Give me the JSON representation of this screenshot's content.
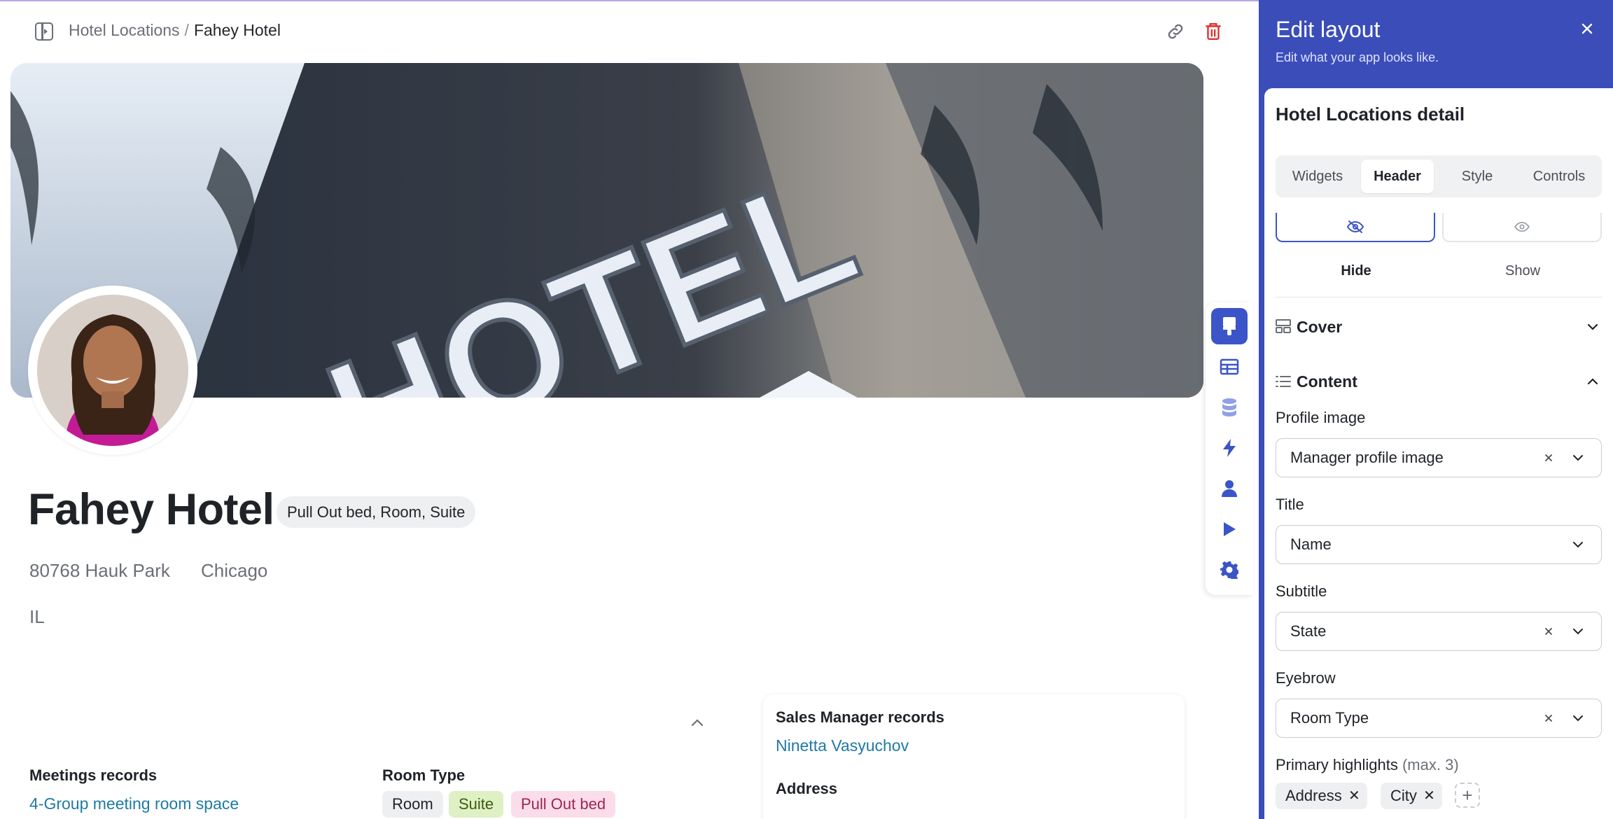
{
  "breadcrumb": {
    "parent": "Hotel Locations",
    "separator": "/",
    "current": "Fahey Hotel"
  },
  "header": {
    "cover_sign_text": "HOTEL"
  },
  "record": {
    "title": "Fahey Hotel",
    "eyebrow": "Pull Out bed, Room, Suite",
    "highlights": [
      "80768 Hauk Park",
      "Chicago"
    ],
    "subtitle": "IL"
  },
  "fields": {
    "meetings": {
      "label": "Meetings records",
      "value": "4-Group meeting room space"
    },
    "room_type": {
      "label": "Room Type",
      "tags": [
        {
          "text": "Room",
          "bg": "#eeeff1",
          "fg": "#1f2328"
        },
        {
          "text": "Suite",
          "bg": "#dff0c4",
          "fg": "#3d5a12"
        },
        {
          "text": "Pull Out bed",
          "bg": "#fbdde9",
          "fg": "#9b2556"
        }
      ]
    },
    "sales_manager": {
      "label": "Sales Manager records",
      "value": "Ninetta Vasyuchov"
    },
    "address": {
      "label": "Address"
    }
  },
  "rail": {
    "icons": [
      "paintbrush-icon",
      "table-icon",
      "database-icon",
      "bolt-icon",
      "user-icon",
      "play-icon",
      "gear-icon"
    ],
    "active": "paintbrush-icon"
  },
  "panel": {
    "title": "Edit layout",
    "subtitle": "Edit what your app looks like.",
    "section_title": "Hotel Locations detail",
    "tabs": [
      "Widgets",
      "Header",
      "Style",
      "Controls"
    ],
    "active_tab": "Header",
    "visibility": {
      "hide": "Hide",
      "show": "Show",
      "selected": "Hide"
    },
    "cover_label": "Cover",
    "content_label": "Content",
    "profile_image": {
      "label": "Profile image",
      "value": "Manager profile image"
    },
    "title_field": {
      "label": "Title",
      "value": "Name"
    },
    "subtitle_field": {
      "label": "Subtitle",
      "value": "State"
    },
    "eyebrow_field": {
      "label": "Eyebrow",
      "value": "Room Type"
    },
    "primary_highlights": {
      "label": "Primary highlights",
      "hint": "(max. 3)",
      "chips": [
        "Address",
        "City"
      ]
    }
  },
  "colors": {
    "accent": "#3b4db8",
    "link": "#1f7aa3",
    "danger": "#e03131"
  }
}
